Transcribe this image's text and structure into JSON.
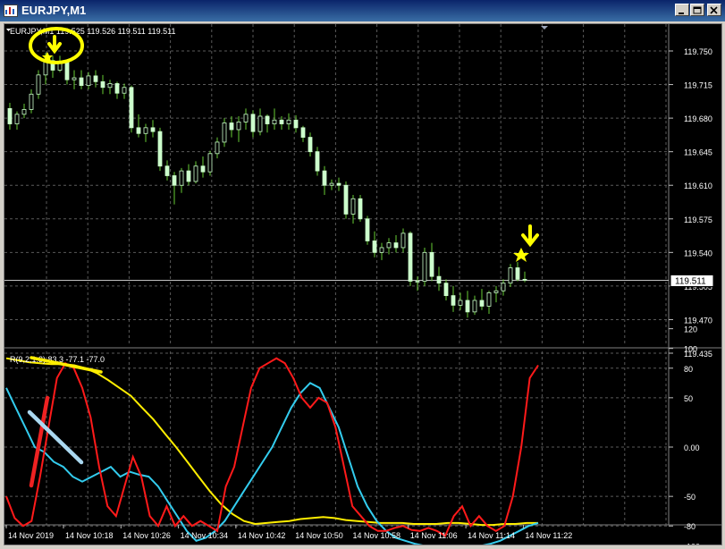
{
  "window": {
    "title": "EURJPY,M1",
    "buttons": [
      "minimize",
      "maximize",
      "close"
    ]
  },
  "price_chart": {
    "header": "EURJPY,M1  119.525 119.526 119.511 119.511",
    "price_levels": [
      "119.750",
      "119.715",
      "119.680",
      "119.645",
      "119.610",
      "119.575",
      "119.540",
      "119.505",
      "119.470",
      "119.435"
    ],
    "current_price": "119.511",
    "colors": {
      "background": "#000000",
      "grid": "#5a5a5a",
      "bull": "#ccffcc",
      "bear": "#66cc33",
      "price_line": "#c0c0c0",
      "annotation": "#ffff00"
    }
  },
  "indicator": {
    "header": "R(9,2,1.3) 83.3 -77.1 -77.0",
    "levels": [
      "120",
      "100",
      "80",
      "50",
      "0.00",
      "-50",
      "-80",
      "-100"
    ],
    "series_colors": {
      "red": "#ff1a1a",
      "cyan": "#33ccee",
      "yellow": "#ffee00"
    }
  },
  "time_axis": [
    "14 Nov 2019",
    "14 Nov 10:18",
    "14 Nov 10:26",
    "14 Nov 10:34",
    "14 Nov 10:42",
    "14 Nov 10:50",
    "14 Nov 10:58",
    "14 Nov 11:06",
    "14 Nov 11:14",
    "14 Nov 11:22"
  ],
  "chart_data": {
    "type": "candlestick",
    "candles": [
      [
        119.69,
        119.696,
        119.668,
        119.674
      ],
      [
        119.674,
        119.687,
        119.668,
        119.684
      ],
      [
        119.684,
        119.695,
        119.68,
        119.689
      ],
      [
        119.689,
        119.71,
        119.685,
        119.705
      ],
      [
        119.705,
        119.73,
        119.7,
        119.725
      ],
      [
        119.725,
        119.748,
        119.715,
        119.74
      ],
      [
        119.74,
        119.745,
        119.722,
        119.73
      ],
      [
        119.73,
        119.745,
        119.728,
        119.738
      ],
      [
        119.738,
        119.74,
        119.715,
        119.72
      ],
      [
        119.72,
        119.73,
        119.71,
        119.722
      ],
      [
        119.722,
        119.73,
        119.71,
        119.714
      ],
      [
        119.714,
        119.728,
        119.71,
        119.724
      ],
      [
        119.724,
        119.73,
        119.712,
        119.718
      ],
      [
        119.718,
        119.725,
        119.705,
        119.712
      ],
      [
        119.712,
        119.72,
        119.705,
        119.716
      ],
      [
        119.716,
        119.718,
        119.7,
        119.706
      ],
      [
        119.706,
        119.716,
        119.7,
        119.712
      ],
      [
        119.712,
        119.714,
        119.665,
        119.67
      ],
      [
        119.67,
        119.684,
        119.66,
        119.664
      ],
      [
        119.664,
        119.674,
        119.655,
        119.67
      ],
      [
        119.67,
        119.678,
        119.66,
        119.666
      ],
      [
        119.666,
        119.67,
        119.625,
        119.63
      ],
      [
        119.63,
        119.636,
        119.615,
        119.62
      ],
      [
        119.62,
        119.624,
        119.59,
        119.61
      ],
      [
        119.61,
        119.628,
        119.602,
        119.625
      ],
      [
        119.625,
        119.632,
        119.61,
        119.614
      ],
      [
        119.614,
        119.635,
        119.612,
        119.63
      ],
      [
        119.63,
        119.64,
        119.618,
        119.624
      ],
      [
        119.624,
        119.646,
        119.62,
        119.643
      ],
      [
        119.643,
        119.66,
        119.638,
        119.655
      ],
      [
        119.655,
        119.68,
        119.65,
        119.675
      ],
      [
        119.675,
        119.682,
        119.66,
        119.668
      ],
      [
        119.668,
        119.682,
        119.655,
        119.676
      ],
      [
        119.676,
        119.69,
        119.668,
        119.684
      ],
      [
        119.684,
        119.688,
        119.66,
        119.666
      ],
      [
        119.666,
        119.69,
        119.662,
        119.682
      ],
      [
        119.682,
        119.684,
        119.665,
        119.674
      ],
      [
        119.674,
        119.69,
        119.668,
        119.678
      ],
      [
        119.678,
        119.682,
        119.668,
        119.674
      ],
      [
        119.674,
        119.685,
        119.668,
        119.678
      ],
      [
        119.678,
        119.683,
        119.665,
        119.67
      ],
      [
        119.67,
        119.672,
        119.655,
        119.66
      ],
      [
        119.66,
        119.665,
        119.64,
        119.645
      ],
      [
        119.645,
        119.65,
        119.62,
        119.625
      ],
      [
        119.625,
        119.63,
        119.6,
        119.61
      ],
      [
        119.61,
        119.616,
        119.605,
        119.612
      ],
      [
        119.612,
        119.618,
        119.604,
        119.61
      ],
      [
        119.61,
        119.614,
        119.575,
        119.58
      ],
      [
        119.58,
        119.6,
        119.57,
        119.596
      ],
      [
        119.596,
        119.6,
        119.572,
        119.575
      ],
      [
        119.575,
        119.578,
        119.548,
        119.552
      ],
      [
        119.552,
        119.562,
        119.535,
        119.54
      ],
      [
        119.54,
        119.55,
        119.532,
        119.545
      ],
      [
        119.545,
        119.555,
        119.538,
        119.55
      ],
      [
        119.55,
        119.558,
        119.54,
        119.545
      ],
      [
        119.545,
        119.565,
        119.54,
        119.56
      ],
      [
        119.56,
        119.562,
        119.505,
        119.51
      ],
      [
        119.51,
        119.515,
        119.5,
        119.51
      ],
      [
        119.51,
        119.545,
        119.505,
        119.54
      ],
      [
        119.54,
        119.55,
        119.51,
        119.515
      ],
      [
        119.515,
        119.525,
        119.5,
        119.508
      ],
      [
        119.508,
        119.512,
        119.49,
        119.495
      ],
      [
        119.495,
        119.505,
        119.478,
        119.485
      ],
      [
        119.485,
        119.498,
        119.48,
        119.49
      ],
      [
        119.49,
        119.5,
        119.472,
        119.478
      ],
      [
        119.478,
        119.495,
        119.475,
        119.49
      ],
      [
        119.49,
        119.502,
        119.48,
        119.484
      ],
      [
        119.484,
        119.5,
        119.476,
        119.498
      ],
      [
        119.498,
        119.505,
        119.488,
        119.5
      ],
      [
        119.5,
        119.512,
        119.495,
        119.508
      ],
      [
        119.508,
        119.528,
        119.504,
        119.524
      ],
      [
        119.524,
        119.53,
        119.51,
        119.512
      ],
      [
        119.512,
        119.52,
        119.509,
        119.511
      ]
    ],
    "ylim": [
      119.435,
      119.76
    ],
    "indicator_series": {
      "red": [
        -50,
        -72,
        -80,
        -75,
        -30,
        20,
        70,
        85,
        80,
        60,
        30,
        -20,
        -60,
        -70,
        -40,
        -10,
        -30,
        -70,
        -80,
        -60,
        -80,
        -70,
        -80,
        -75,
        -80,
        -85,
        -40,
        -20,
        20,
        60,
        80,
        85,
        90,
        85,
        70,
        50,
        40,
        50,
        45,
        20,
        -20,
        -60,
        -70,
        -80,
        -85,
        -85,
        -82,
        -80,
        -84,
        -85,
        -82,
        -85,
        -90,
        -70,
        -60,
        -80,
        -70,
        -80,
        -85,
        -80,
        -50,
        0,
        70,
        83
      ],
      "cyan": [
        60,
        40,
        20,
        0,
        -5,
        -15,
        -20,
        -30,
        -35,
        -30,
        -25,
        -20,
        -30,
        -25,
        -28,
        -30,
        -40,
        -55,
        -70,
        -85,
        -95,
        -92,
        -85,
        -75,
        -60,
        -45,
        -30,
        -15,
        0,
        20,
        40,
        55,
        65,
        60,
        40,
        20,
        -10,
        -40,
        -60,
        -75,
        -85,
        -92,
        -95,
        -98,
        -100,
        -100,
        -100,
        -100,
        -100,
        -100,
        -100,
        -98,
        -95,
        -90,
        -85,
        -80,
        -77
      ],
      "yellow": [
        90,
        88,
        86,
        85,
        84,
        84,
        83,
        80,
        75,
        68,
        60,
        52,
        40,
        28,
        14,
        0,
        -15,
        -30,
        -45,
        -58,
        -68,
        -75,
        -78,
        -77,
        -76,
        -75,
        -73,
        -72,
        -71,
        -72,
        -74,
        -75,
        -76,
        -77,
        -77,
        -77,
        -78,
        -78,
        -78,
        -77,
        -77,
        -78,
        -79,
        -79,
        -78,
        -78,
        -77,
        -77
      ]
    }
  }
}
